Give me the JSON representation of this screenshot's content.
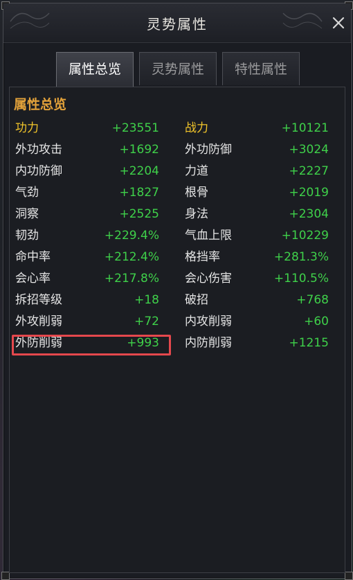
{
  "window": {
    "title": "灵势属性"
  },
  "tabs": [
    {
      "label": "属性总览",
      "active": true
    },
    {
      "label": "灵势属性",
      "active": false
    },
    {
      "label": "特性属性",
      "active": false
    }
  ],
  "section_title": "属性总览",
  "stats_left": [
    {
      "label": "功力",
      "value": "+23551"
    },
    {
      "label": "外功攻击",
      "value": "+1692"
    },
    {
      "label": "内功防御",
      "value": "+2204"
    },
    {
      "label": "气劲",
      "value": "+1827"
    },
    {
      "label": "洞察",
      "value": "+2525"
    },
    {
      "label": "韧劲",
      "value": "+229.4%"
    },
    {
      "label": "命中率",
      "value": "+212.4%"
    },
    {
      "label": "会心率",
      "value": "+217.8%"
    },
    {
      "label": "拆招等级",
      "value": "+18"
    },
    {
      "label": "外攻削弱",
      "value": "+72"
    },
    {
      "label": "外防削弱",
      "value": "+993"
    }
  ],
  "stats_right": [
    {
      "label": "战力",
      "value": "+10121"
    },
    {
      "label": "外功防御",
      "value": "+3024"
    },
    {
      "label": "力道",
      "value": "+2227"
    },
    {
      "label": "根骨",
      "value": "+2019"
    },
    {
      "label": "身法",
      "value": "+2304"
    },
    {
      "label": "气血上限",
      "value": "+10229"
    },
    {
      "label": "格挡率",
      "value": "+281.3%"
    },
    {
      "label": "会心伤害",
      "value": "+110.5%"
    },
    {
      "label": "破招",
      "value": "+768"
    },
    {
      "label": "内攻削弱",
      "value": "+60"
    },
    {
      "label": "内防削弱",
      "value": "+1215"
    }
  ],
  "colors": {
    "accent_gold": "#e3a23a",
    "highlight_label": "#f2c52a",
    "value_green": "#3fd14a",
    "highlight_box": "#e5484d"
  }
}
